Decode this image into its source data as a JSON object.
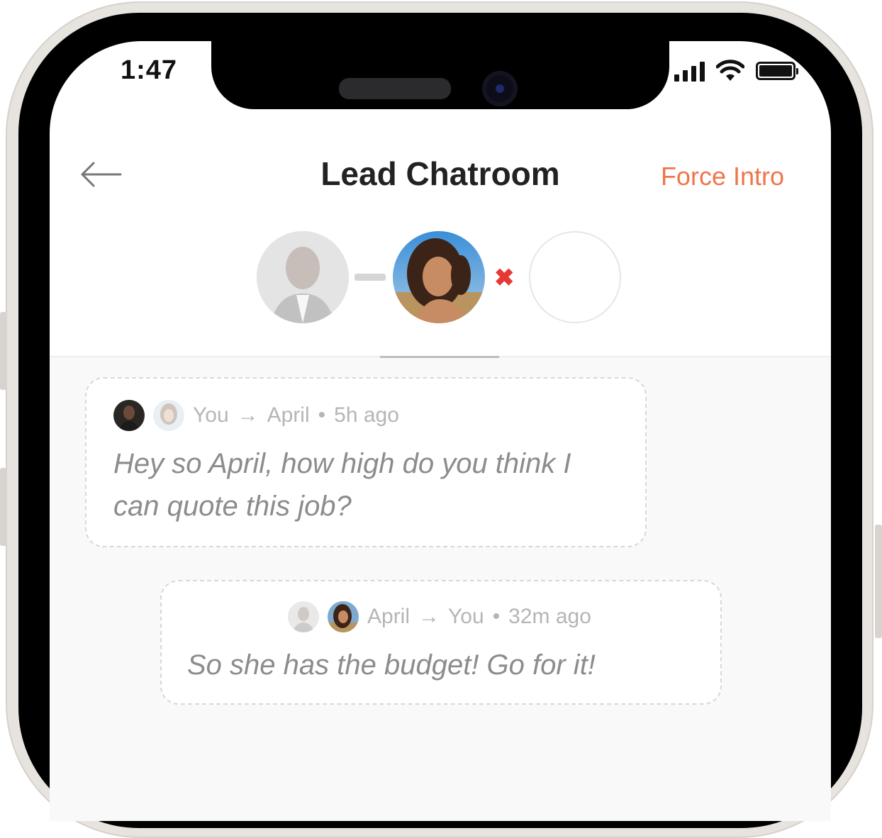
{
  "status_bar": {
    "time": "1:47"
  },
  "header": {
    "title": "Lead Chatroom",
    "action_label": "Force Intro",
    "action_color": "#f0754a"
  },
  "participants": {
    "connection_status_icon": "x-mark-icon",
    "status_color": "#e53935"
  },
  "messages": [
    {
      "from": "You",
      "arrow": "→",
      "to": "April",
      "separator": "•",
      "time": "5h ago",
      "text": "Hey so April, how high do you think I can quote this job?"
    },
    {
      "from": "April",
      "arrow": "→",
      "to": "You",
      "separator": "•",
      "time": "32m ago",
      "text": "So she has the budget! Go for it!"
    }
  ]
}
